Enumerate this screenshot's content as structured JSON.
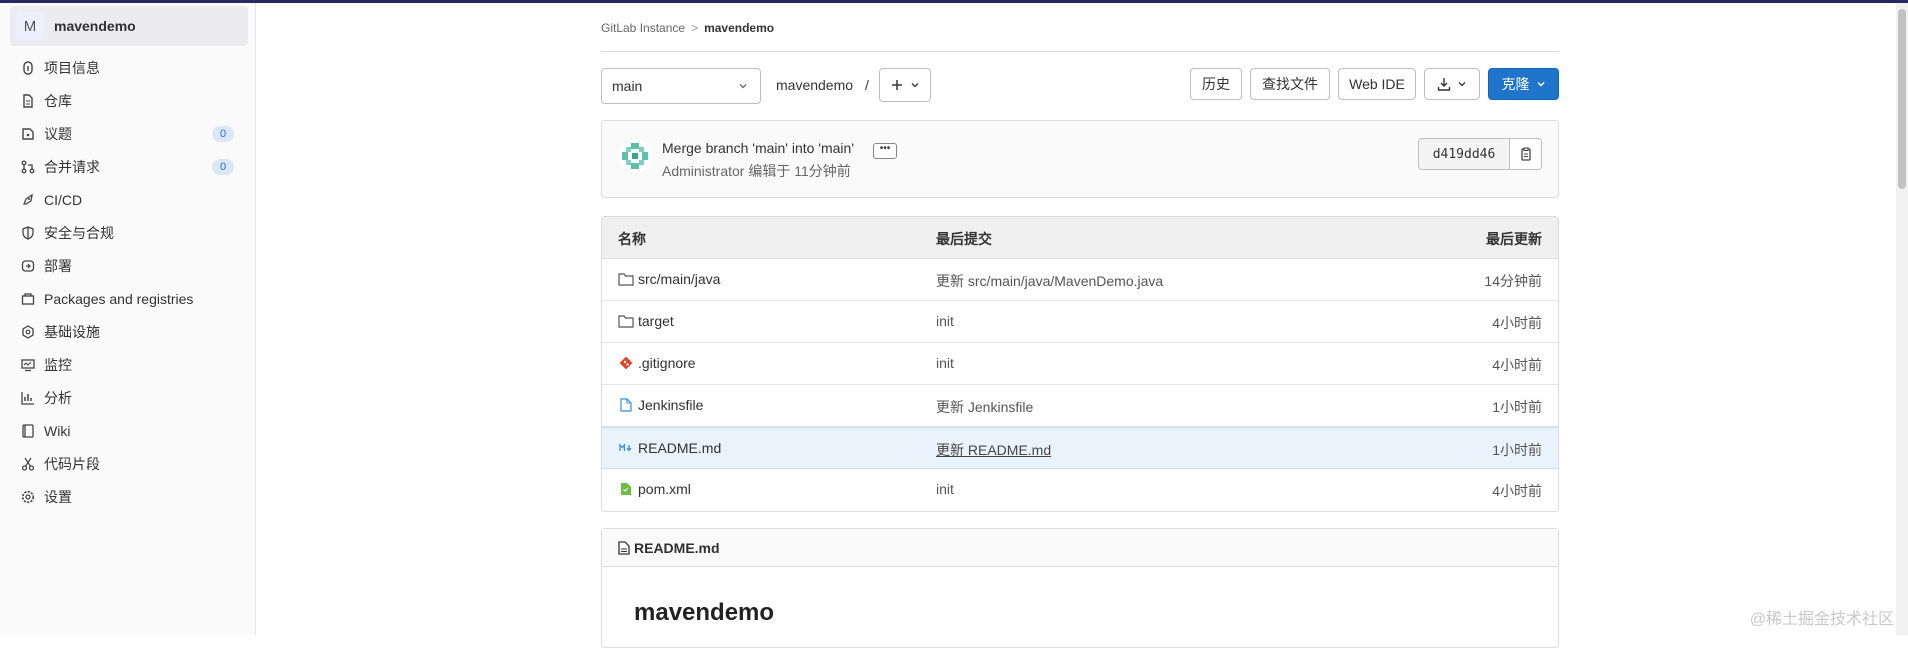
{
  "sidebar": {
    "project_avatar": "M",
    "project_name": "mavendemo",
    "items": [
      {
        "label": "项目信息",
        "icon": "info-icon",
        "badge": ""
      },
      {
        "label": "仓库",
        "icon": "doc-icon",
        "badge": ""
      },
      {
        "label": "议题",
        "icon": "issues-icon",
        "badge": "0"
      },
      {
        "label": "合并请求",
        "icon": "merge-icon",
        "badge": "0"
      },
      {
        "label": "CI/CD",
        "icon": "rocket-icon",
        "badge": ""
      },
      {
        "label": "安全与合规",
        "icon": "shield-icon",
        "badge": ""
      },
      {
        "label": "部署",
        "icon": "deploy-icon",
        "badge": ""
      },
      {
        "label": "Packages and registries",
        "icon": "package-icon",
        "badge": ""
      },
      {
        "label": "基础设施",
        "icon": "cloud-icon",
        "badge": ""
      },
      {
        "label": "监控",
        "icon": "monitor-icon",
        "badge": ""
      },
      {
        "label": "分析",
        "icon": "chart-icon",
        "badge": ""
      },
      {
        "label": "Wiki",
        "icon": "book-icon",
        "badge": ""
      },
      {
        "label": "代码片段",
        "icon": "snippet-icon",
        "badge": ""
      },
      {
        "label": "设置",
        "icon": "gear-icon",
        "badge": ""
      }
    ]
  },
  "breadcrumb": {
    "root": "GitLab Instance",
    "current": "mavendemo",
    "separator": ">"
  },
  "toolbar": {
    "branch": "main",
    "path": "mavendemo",
    "path_sep": "/",
    "history": "历史",
    "find_file": "查找文件",
    "web_ide": "Web IDE",
    "clone": "克隆"
  },
  "commit": {
    "message": "Merge branch 'main' into 'main'",
    "author": "Administrator",
    "meta": "编辑于 11分钟前",
    "sha": "d419dd46"
  },
  "table": {
    "headers": [
      "名称",
      "最后提交",
      "最后更新"
    ],
    "rows": [
      {
        "name": "src/main/java",
        "icon": "folder-icon",
        "commit": "更新 src/main/java/MavenDemo.java",
        "updated": "14分钟前"
      },
      {
        "name": "target",
        "icon": "folder-icon",
        "commit": "init",
        "updated": "4小时前"
      },
      {
        "name": ".gitignore",
        "icon": "git-icon",
        "commit": "init",
        "updated": "4小时前"
      },
      {
        "name": "Jenkinsfile",
        "icon": "file-icon",
        "commit": "更新 Jenkinsfile",
        "updated": "1小时前"
      },
      {
        "name": "README.md",
        "icon": "markdown-icon",
        "commit": "更新 README.md",
        "updated": "1小时前"
      },
      {
        "name": "pom.xml",
        "icon": "xml-file-icon",
        "commit": "init",
        "updated": "4小时前"
      }
    ]
  },
  "readme": {
    "filename": "README.md",
    "heading": "mavendemo"
  },
  "watermark": "@稀土掘金技术社区",
  "colors": {
    "topbar": "#292961",
    "clone_button": "#1f75cb",
    "highlight_row": "#e9f3fc"
  }
}
